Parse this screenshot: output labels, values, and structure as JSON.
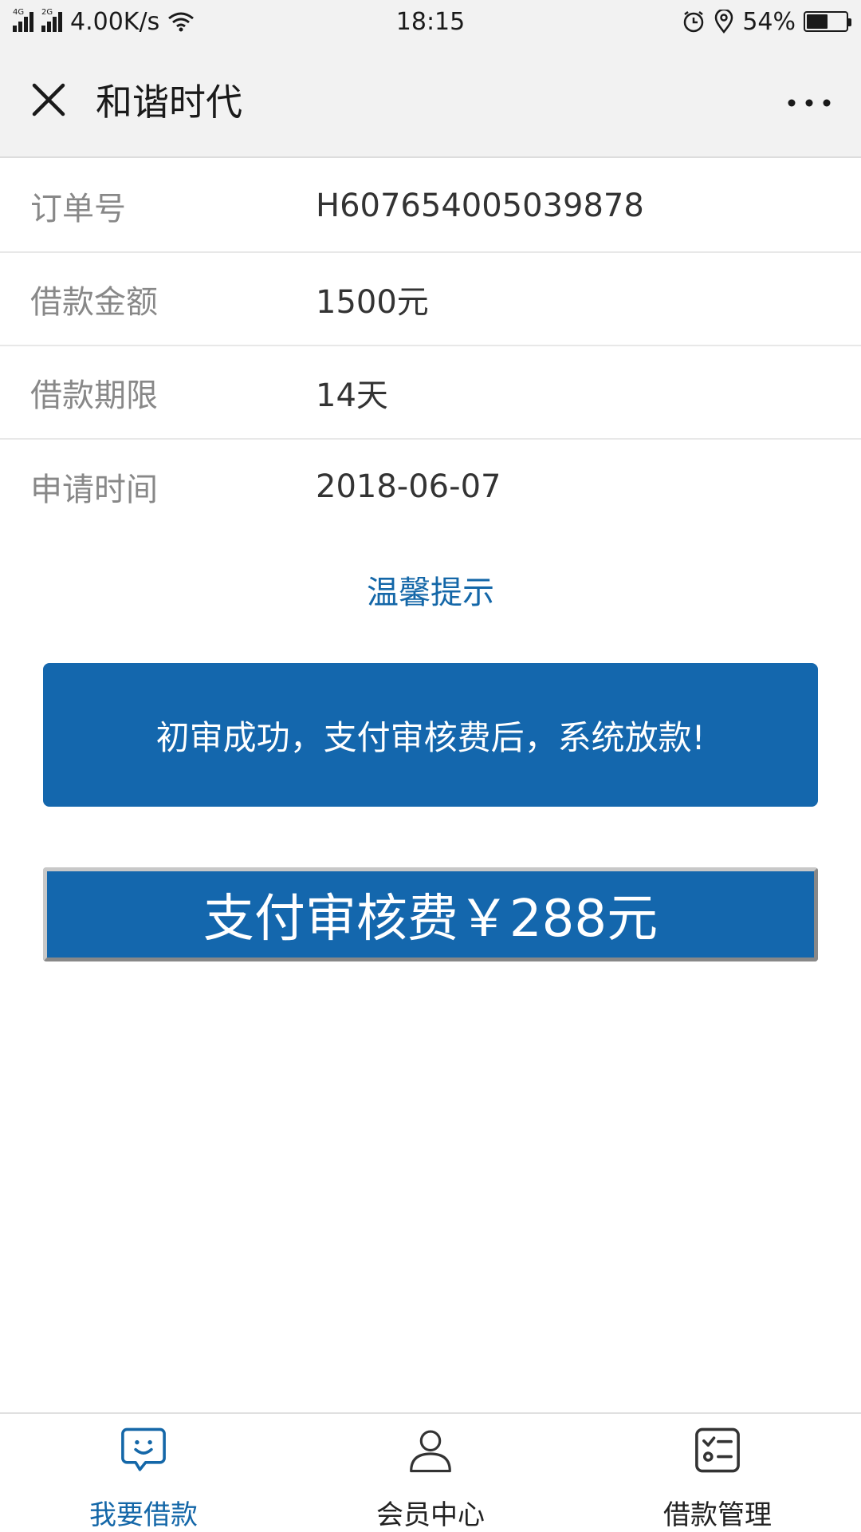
{
  "status_bar": {
    "network_4g": "4G",
    "network_2g": "2G",
    "speed": "4.00K/s",
    "time": "18:15",
    "battery": "54%",
    "battery_level": 0.54
  },
  "nav": {
    "title": "和谐时代"
  },
  "info": [
    {
      "label": "订单号",
      "value": "H607654005039878"
    },
    {
      "label": "借款金额",
      "value": "1500元"
    },
    {
      "label": "借款期限",
      "value": "14天"
    },
    {
      "label": "申请时间",
      "value": "2018-06-07"
    }
  ],
  "tip": {
    "title": "温馨提示",
    "message": "初审成功，支付审核费后，系统放款!"
  },
  "pay_button": {
    "label": "支付审核费￥288元"
  },
  "tabs": [
    {
      "label": "我要借款",
      "icon": "chat-smile-icon",
      "active": true
    },
    {
      "label": "会员中心",
      "icon": "person-icon",
      "active": false
    },
    {
      "label": "借款管理",
      "icon": "checklist-icon",
      "active": false
    }
  ],
  "colors": {
    "accent": "#1467ad",
    "tab_active": "#1467a8"
  }
}
